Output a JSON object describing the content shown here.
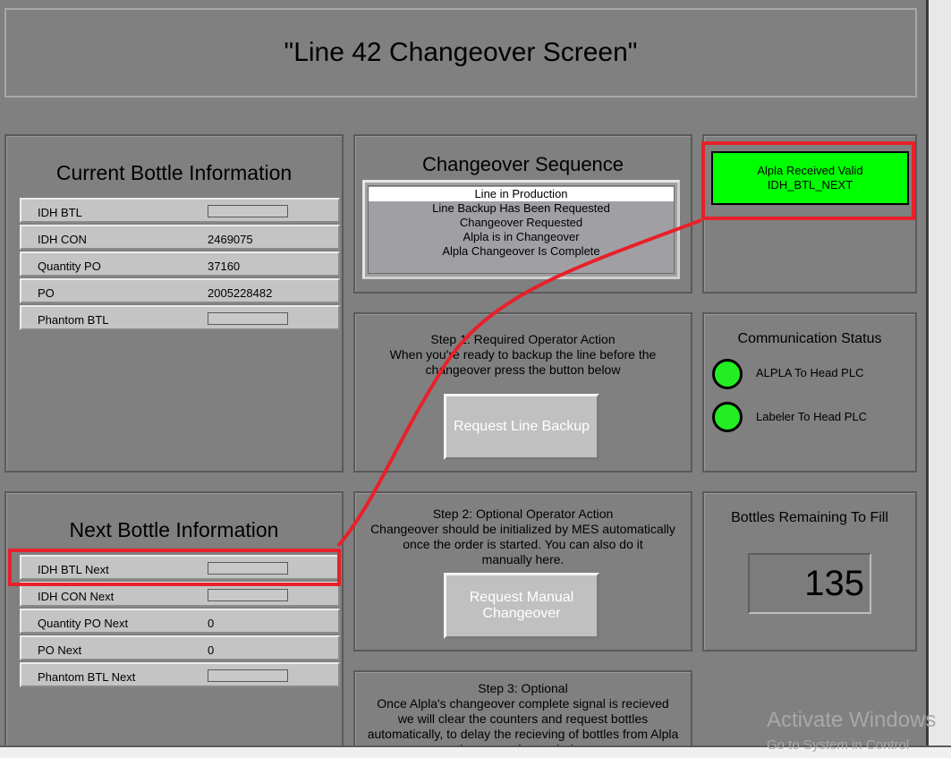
{
  "title": "\"Line 42 Changeover Screen\"",
  "current_bottle": {
    "title": "Current Bottle Information",
    "rows": [
      {
        "label": "IDH BTL",
        "value": ""
      },
      {
        "label": "IDH CON",
        "value": "2469075"
      },
      {
        "label": "Quantity PO",
        "value": "37160"
      },
      {
        "label": "PO",
        "value": "2005228482"
      },
      {
        "label": "Phantom BTL",
        "value": ""
      }
    ]
  },
  "next_bottle": {
    "title": "Next Bottle Information",
    "rows": [
      {
        "label": "IDH BTL Next",
        "value": ""
      },
      {
        "label": "IDH CON Next",
        "value": ""
      },
      {
        "label": "Quantity PO Next",
        "value": "0"
      },
      {
        "label": "PO Next",
        "value": "0"
      },
      {
        "label": "Phantom BTL Next",
        "value": ""
      }
    ]
  },
  "changeover": {
    "title": "Changeover Sequence",
    "items": [
      "Line in Production",
      "Line Backup Has Been Requested",
      "Changeover Requested",
      "Alpla is in Changeover",
      "Alpla Changeover Is Complete"
    ],
    "selected": "Line in Production"
  },
  "alpla_status": {
    "line1": "Alpla Received Valid",
    "line2": "IDH_BTL_NEXT",
    "color": "#00ff00"
  },
  "step1": {
    "title": "Step 1: Required Operator Action",
    "line2": "When you're ready to backup the line before the",
    "line3": "changeover press the button below",
    "button": "Request Line Backup"
  },
  "step2": {
    "title": "Step 2: Optional Operator Action",
    "line2": "Changeover should be initialized by MES automatically",
    "line3": "once the order is started. You can also do it",
    "line4": "manually here.",
    "button_line1": "Request Manual",
    "button_line2": "Changeover"
  },
  "step3": {
    "title": "Step 3: Optional",
    "line2": "Once Alpla's changeover complete signal is recieved",
    "line3": "we will clear the counters and request bottles",
    "line4": "automatically, to delay the recieving of bottles from Alpla",
    "line5": "then press button below"
  },
  "communication": {
    "title": "Communication Status",
    "items": [
      {
        "label": "ALPLA To Head PLC",
        "color": "#22ee22"
      },
      {
        "label": "Labeler To Head PLC",
        "color": "#22ee22"
      }
    ]
  },
  "bottles_remaining": {
    "title": "Bottles Remaining To Fill",
    "value": "135"
  },
  "watermark": {
    "line1": "Activate Windows",
    "line2": "Go to System in Control"
  },
  "highlight_color": "#e8202a"
}
